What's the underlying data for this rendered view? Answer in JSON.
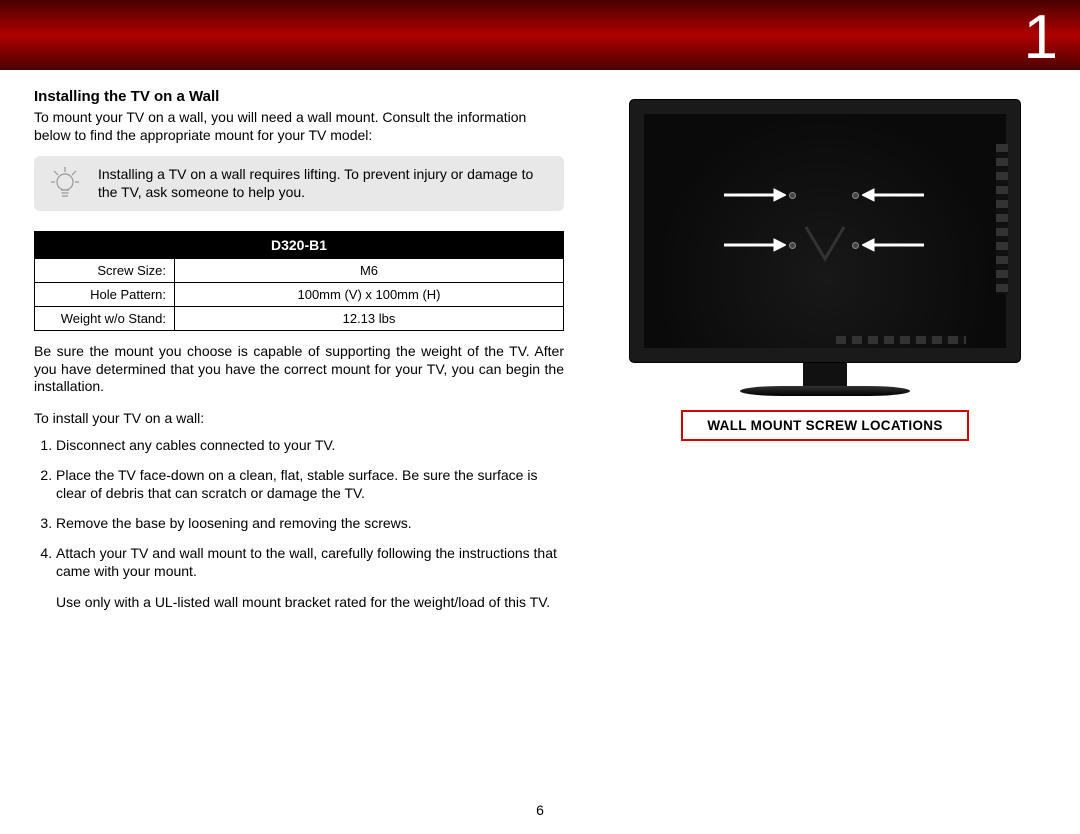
{
  "page_corner_number": "1",
  "heading": "Installing the TV on a Wall",
  "intro": "To mount your TV on a wall, you will need a wall mount. Consult the information below to find the appropriate mount for your TV model:",
  "tip": "Installing a TV on a wall requires lifting. To prevent injury or damage to the TV, ask someone to help you.",
  "spec_table": {
    "header": "D320-B1",
    "rows": [
      {
        "label": "Screw Size:",
        "value": "M6"
      },
      {
        "label": "Hole Pattern:",
        "value": "100mm (V) x 100mm (H)"
      },
      {
        "label": "Weight w/o Stand:",
        "value": "12.13 lbs"
      }
    ]
  },
  "after_table": "Be sure the mount you choose is capable of supporting the weight of the TV. After you have determined that you have the correct mount for your TV, you can begin the installation.",
  "instr_intro": "To install your TV on a wall:",
  "steps": [
    "Disconnect any cables connected to your TV.",
    "Place the TV face-down on a clean, flat, stable surface. Be sure the surface is clear of debris that can scratch or damage the TV.",
    "Remove the base by loosening and removing the screws.",
    "Attach your TV and wall mount to the wall, carefully following the instructions that came with your mount."
  ],
  "ul_note": "Use only with a UL-listed wall mount bracket rated for the weight/load of this TV.",
  "figure_caption": "WALL MOUNT SCREW LOCATIONS",
  "page_number": "6"
}
